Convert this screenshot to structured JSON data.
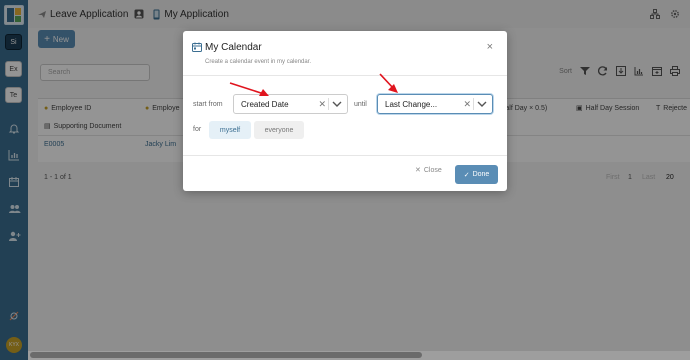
{
  "topbar": {
    "app_title": "Leave Application",
    "page_title": "My Application"
  },
  "sidebar": {
    "apps": [
      "Si",
      "Ex",
      "Te"
    ],
    "avatar_label": "KYX"
  },
  "main": {
    "new_button": "New",
    "search_placeholder": "Search",
    "sort_label": "Sort",
    "columns": {
      "employee_id": "Employee ID",
      "employee_name": "Employe",
      "half_day": "(Half Day × 0.5)",
      "half_day_session": "Half Day Session",
      "rejected": "Rejecte",
      "supporting_document": "Supporting Document"
    },
    "rows": [
      {
        "employee_id": "E0005",
        "employee_name": "Jacky Lim"
      }
    ],
    "record_count": "1 - 1 of 1",
    "pagination": {
      "first": "First",
      "page": "1",
      "last": "Last",
      "page_size": "20"
    }
  },
  "modal": {
    "title": "My Calendar",
    "subtitle": "Create a calendar event in my calendar.",
    "start_label": "start from",
    "start_value": "Created Date",
    "until_label": "until",
    "until_value": "Last Change...",
    "for_label": "for",
    "for_options": [
      "myself",
      "everyone"
    ],
    "selected_for": "myself",
    "close_label": "Close",
    "done_label": "Done"
  },
  "colors": {
    "sidebar": "#3b6e91",
    "accent": "#5a8db5",
    "annotation_arrow": "#e0141e"
  }
}
